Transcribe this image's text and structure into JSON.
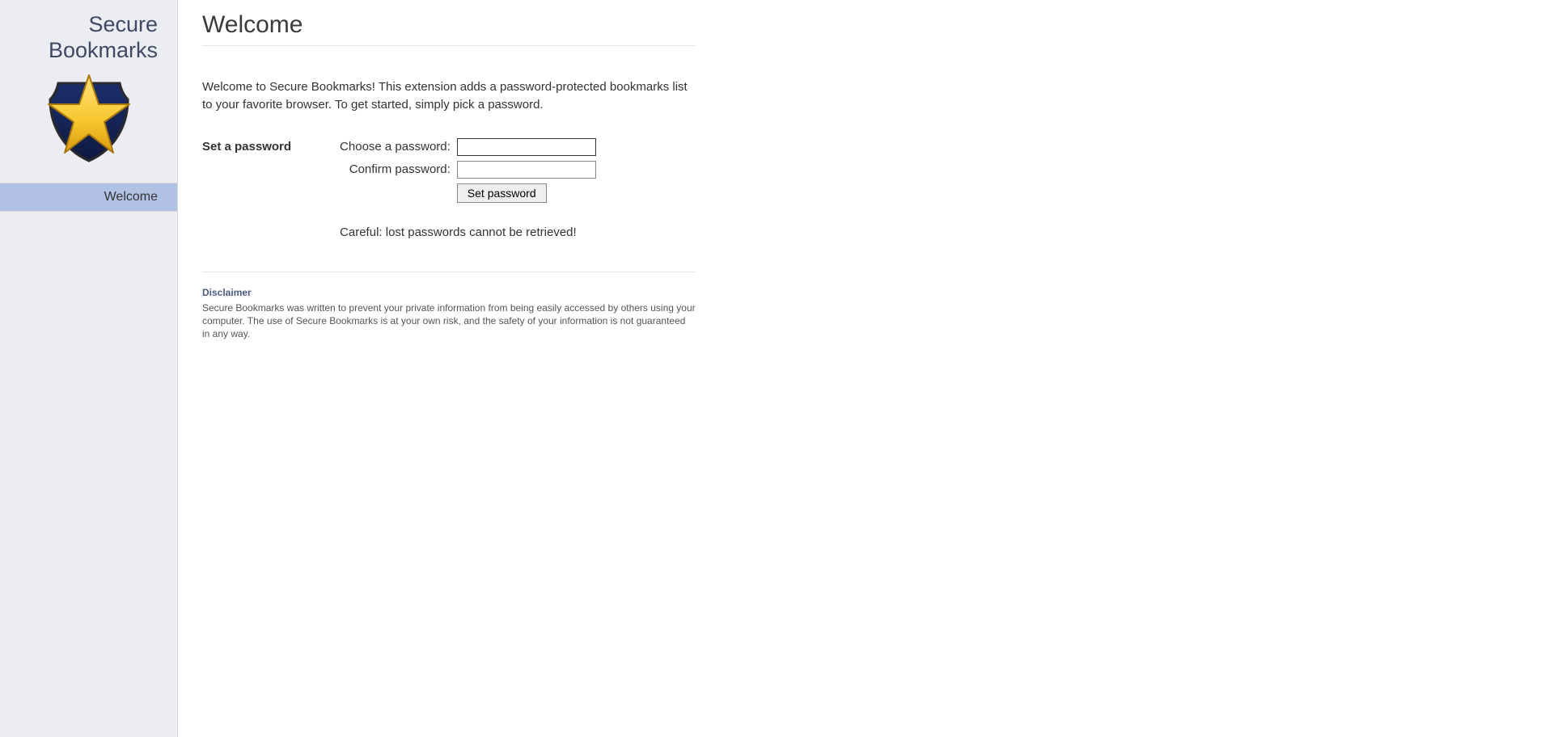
{
  "sidebar": {
    "title_line1": "Secure",
    "title_line2": "Bookmarks",
    "nav": [
      {
        "label": "Welcome",
        "active": true
      }
    ]
  },
  "main": {
    "title": "Welcome",
    "intro": "Welcome to Secure Bookmarks! This extension adds a password-protected bookmarks list to your favorite browser. To get started, simply pick a password.",
    "form": {
      "heading": "Set a password",
      "choose_label": "Choose a password:",
      "confirm_label": "Confirm password:",
      "choose_value": "",
      "confirm_value": "",
      "submit_label": "Set password",
      "warning": "Careful: lost passwords cannot be retrieved!"
    },
    "disclaimer": {
      "heading": "Disclaimer",
      "text": "Secure Bookmarks was written to prevent your private information from being easily accessed by others using your computer. The use of Secure Bookmarks is at your own risk, and the safety of your information is not guaranteed in any way."
    }
  }
}
